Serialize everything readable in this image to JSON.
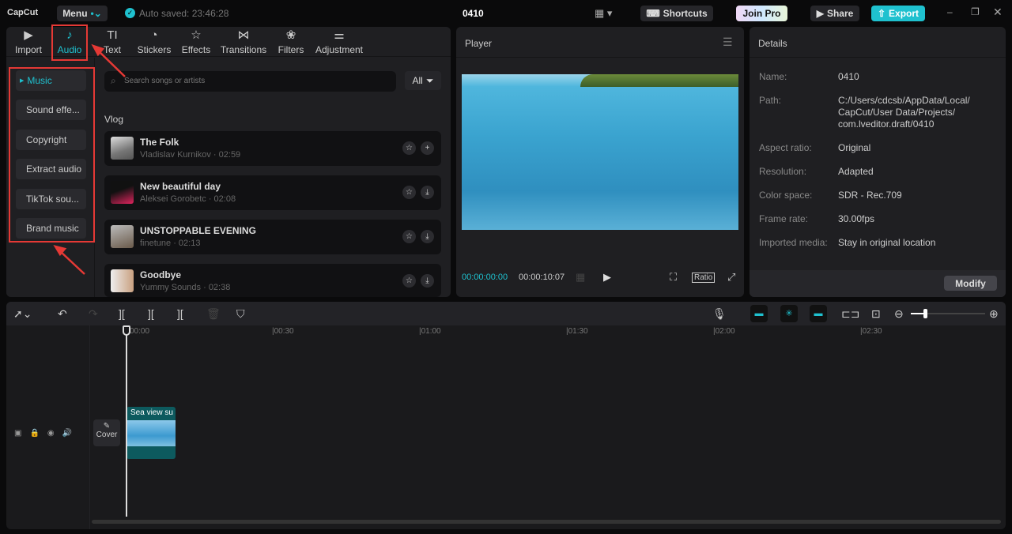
{
  "app": {
    "logo": "CapCut",
    "menu": "Menu",
    "autosave": "Auto saved: 23:46:28",
    "project": "0410",
    "shortcuts": "Shortcuts",
    "join_pro": "Join Pro",
    "share": "Share",
    "export": "Export"
  },
  "tabs": [
    {
      "label": "Import",
      "icon": "import-icon"
    },
    {
      "label": "Audio",
      "icon": "audio-icon"
    },
    {
      "label": "Text",
      "icon": "text-icon"
    },
    {
      "label": "Stickers",
      "icon": "stickers-icon"
    },
    {
      "label": "Effects",
      "icon": "effects-icon"
    },
    {
      "label": "Transitions",
      "icon": "transitions-icon"
    },
    {
      "label": "Filters",
      "icon": "filters-icon"
    },
    {
      "label": "Adjustment",
      "icon": "adjustment-icon"
    }
  ],
  "categories": [
    "Music",
    "Sound effe...",
    "Copyright",
    "Extract audio",
    "TikTok sou...",
    "Brand music"
  ],
  "search": {
    "placeholder": "Search songs or artists",
    "filter": "All"
  },
  "section": "Vlog",
  "songs": [
    {
      "title": "The Folk",
      "sub": "Vladislav Kurnikov · 02:59",
      "action": "+"
    },
    {
      "title": "New beautiful day",
      "sub": "Aleksei Gorobetc · 02:08",
      "action": "⤓"
    },
    {
      "title": "UNSTOPPABLE EVENING",
      "sub": "finetune · 02:13",
      "action": "⤓"
    },
    {
      "title": "Goodbye",
      "sub": "Yummy Sounds · 02:38",
      "action": "⤓"
    }
  ],
  "player": {
    "title": "Player",
    "current": "00:00:00:00",
    "total": "00:00:10:07",
    "ratio": "Ratio"
  },
  "details": {
    "title": "Details",
    "rows": [
      {
        "label": "Name:",
        "value": "0410"
      },
      {
        "label": "Path:",
        "value": "C:/Users/cdcsb/AppData/Local/ CapCut/User Data/Projects/ com.lveditor.draft/0410"
      },
      {
        "label": "Aspect ratio:",
        "value": "Original"
      },
      {
        "label": "Resolution:",
        "value": "Adapted"
      },
      {
        "label": "Color space:",
        "value": "SDR - Rec.709"
      },
      {
        "label": "Frame rate:",
        "value": "30.00fps"
      },
      {
        "label": "Imported media:",
        "value": "Stay in original location"
      }
    ],
    "modify": "Modify"
  },
  "timeline": {
    "ticks": [
      "00:00",
      "|00:30",
      "|01:00",
      "|01:30",
      "|02:00",
      "|02:30"
    ],
    "cover": "Cover",
    "clip": "Sea view su"
  },
  "colors": {
    "accent": "#1fc1cf",
    "highlight": "#e53935"
  }
}
